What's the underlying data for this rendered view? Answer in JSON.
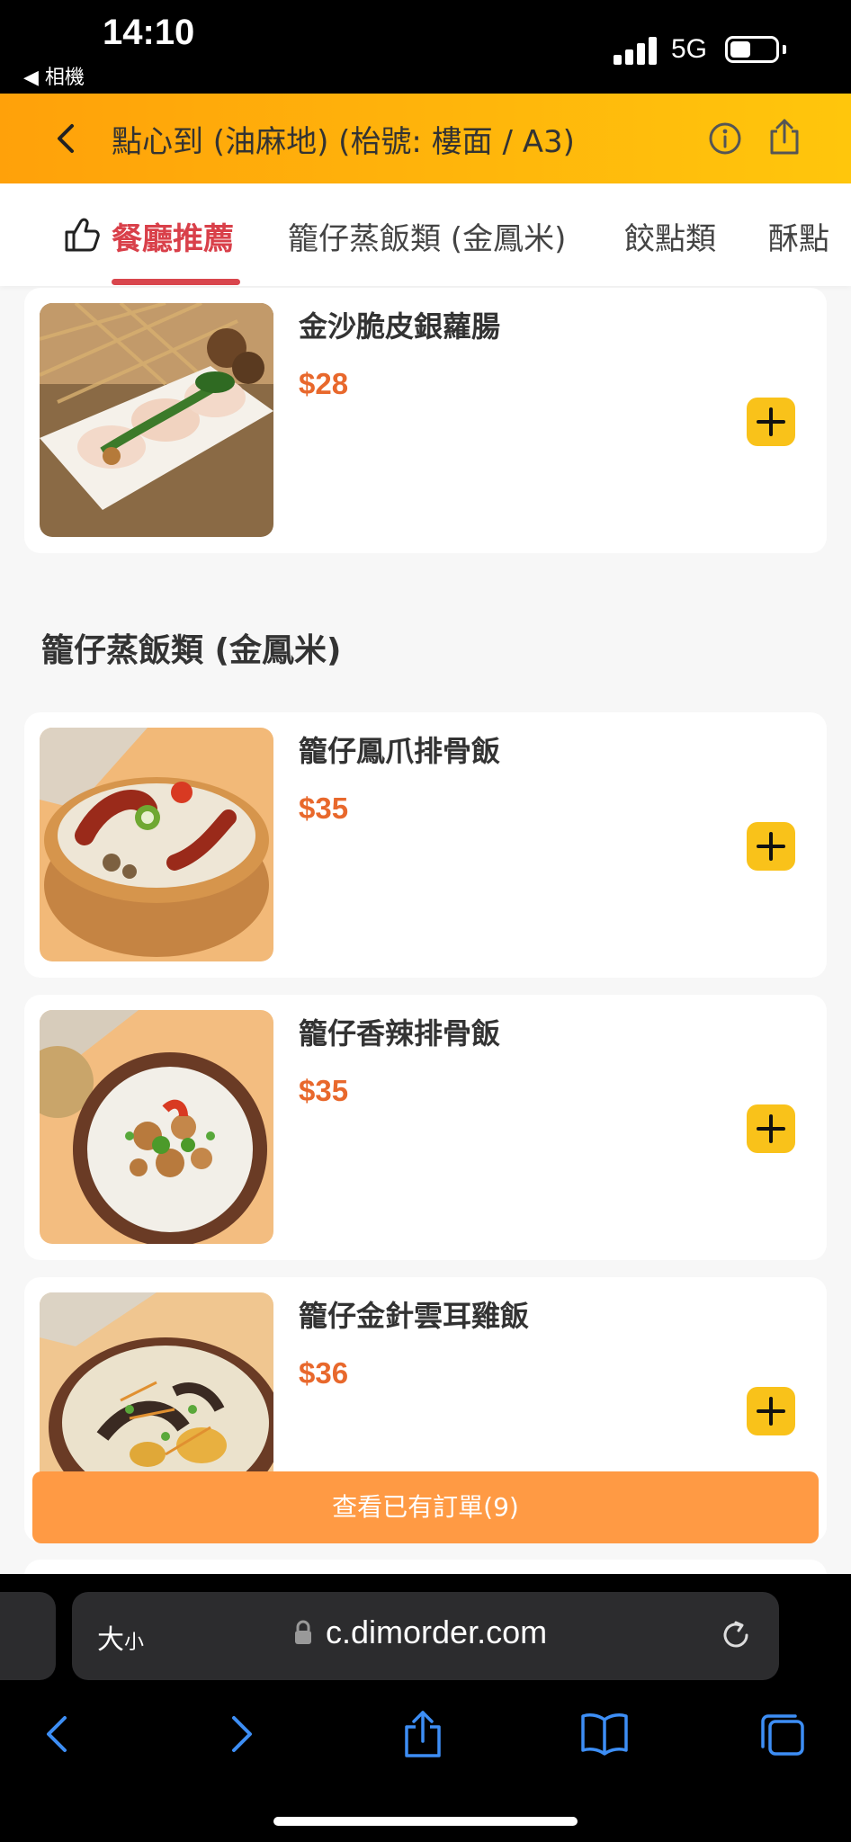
{
  "status_bar": {
    "time": "14:10",
    "back_label": "◀ 相機",
    "network": "5G"
  },
  "header": {
    "title": "點心到 (油麻地) (枱號: 樓面 / A3)"
  },
  "tabs": [
    {
      "label": "餐廳推薦",
      "active": true
    },
    {
      "label": "籠仔蒸飯類 (金鳳米)",
      "active": false
    },
    {
      "label": "餃點類",
      "active": false
    },
    {
      "label": "酥點",
      "active": false
    }
  ],
  "items": [
    {
      "name": "金沙脆皮銀蘿腸",
      "price": "$28"
    },
    {
      "name": "籠仔鳳爪排骨飯",
      "price": "$35"
    },
    {
      "name": "籠仔香辣排骨飯",
      "price": "$35"
    },
    {
      "name": "籠仔金針雲耳雞飯",
      "price": "$36"
    }
  ],
  "sections": {
    "rice": "籠仔蒸飯類 (金鳳米)"
  },
  "order_button": "查看已有訂單(9)",
  "browser": {
    "font_size_label": "大",
    "font_size_small": "小",
    "url": "c.dimorder.com"
  },
  "colors": {
    "header_start": "#ffa10a",
    "header_end": "#ffc60c",
    "active_tab": "#d9404a",
    "price": "#e8682c",
    "add_button": "#f9c21a",
    "order_bar": "#ff9a44",
    "browser_accent": "#3d8ef5"
  },
  "icons": [
    "back-chevron-icon",
    "info-icon",
    "share-icon",
    "thumbs-up-icon",
    "plus-icon",
    "lock-icon",
    "reload-icon",
    "back-arrow-icon",
    "forward-arrow-icon",
    "bookmarks-icon",
    "tabs-icon"
  ]
}
